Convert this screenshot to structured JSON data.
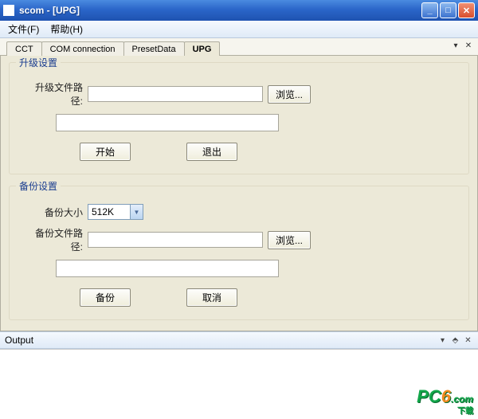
{
  "title": "scom - [UPG]",
  "menu": {
    "file": "文件(F)",
    "help": "帮助(H)"
  },
  "tabs": {
    "cct": "CCT",
    "com": "COM connection",
    "preset": "PresetData",
    "upg": "UPG"
  },
  "upgrade": {
    "legend": "升级设置",
    "path_label": "升级文件路径:",
    "path_value": "",
    "browse": "浏览...",
    "progress_value": "",
    "start": "开始",
    "exit": "退出"
  },
  "backup": {
    "legend": "备份设置",
    "size_label": "备份大小",
    "size_value": "512K",
    "path_label": "备份文件路径:",
    "path_value": "",
    "browse": "浏览...",
    "progress_value": "",
    "backup": "备份",
    "cancel": "取消"
  },
  "output": {
    "label": "Output"
  },
  "watermark": {
    "brand": "PC",
    "six": "6",
    "domain": ".com",
    "sub": "下载"
  }
}
